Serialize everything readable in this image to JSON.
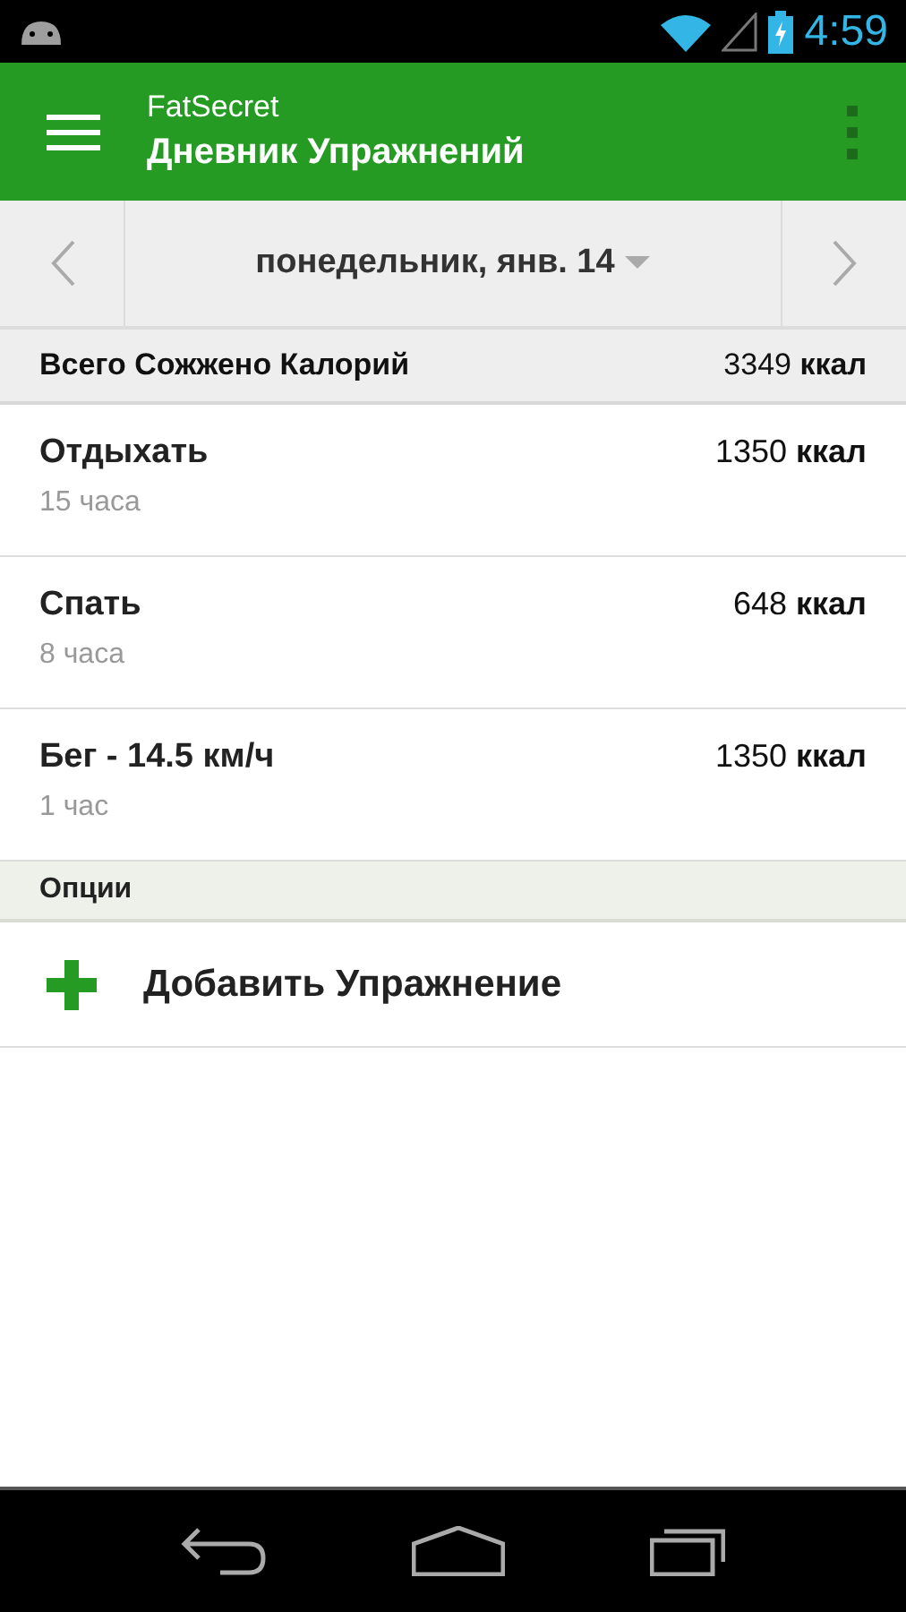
{
  "status_bar": {
    "time": "4:59"
  },
  "app_bar": {
    "app_name": "FatSecret",
    "title": "Дневник Упражнений"
  },
  "date_nav": {
    "label": "понедельник, янв. 14"
  },
  "total": {
    "label": "Всего Сожжено Калорий",
    "value": "3349 **ккал**"
  },
  "entries": [
    {
      "name": "Отдыхать",
      "duration": "15 часа",
      "calories": "1350 **ккал**"
    },
    {
      "name": "Спать",
      "duration": "8 часа",
      "calories": "648 **ккал**"
    },
    {
      "name": "Бег - 14.5 км/ч",
      "duration": "1 час",
      "calories": "1350 **ккал**"
    }
  ],
  "options": {
    "header": "Опции",
    "items": [
      {
        "label": "Добавить Упражнение"
      }
    ]
  }
}
